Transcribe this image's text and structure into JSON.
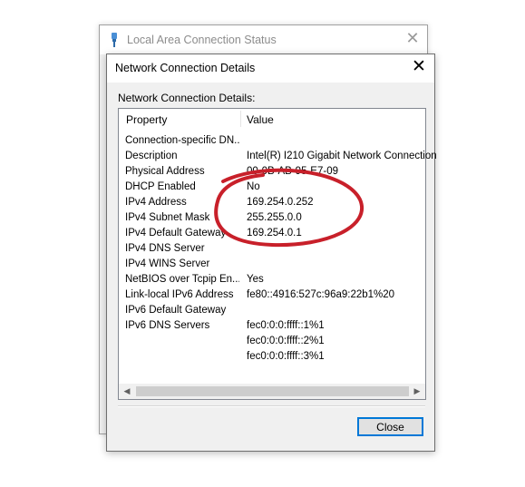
{
  "background_window": {
    "title": "Local Area Connection Status",
    "icon": "network-cable-icon",
    "close_glyph": "✕"
  },
  "dialog": {
    "title": "Network Connection Details",
    "close_glyph": "✕",
    "group_label": "Network Connection Details:",
    "columns": {
      "property": "Property",
      "value": "Value"
    },
    "rows": [
      {
        "property": "Connection-specific DN...",
        "value": ""
      },
      {
        "property": "Description",
        "value": "Intel(R) I210 Gigabit Network Connection"
      },
      {
        "property": "Physical Address",
        "value": "00-0B-AB-95-E7-09"
      },
      {
        "property": "DHCP Enabled",
        "value": "No"
      },
      {
        "property": "IPv4 Address",
        "value": "169.254.0.252"
      },
      {
        "property": "IPv4 Subnet Mask",
        "value": "255.255.0.0"
      },
      {
        "property": "IPv4 Default Gateway",
        "value": "169.254.0.1"
      },
      {
        "property": "IPv4 DNS Server",
        "value": ""
      },
      {
        "property": "IPv4 WINS Server",
        "value": ""
      },
      {
        "property": "NetBIOS over Tcpip En...",
        "value": "Yes"
      },
      {
        "property": "Link-local IPv6 Address",
        "value": "fe80::4916:527c:96a9:22b1%20"
      },
      {
        "property": "IPv6 Default Gateway",
        "value": ""
      },
      {
        "property": "IPv6 DNS Servers",
        "value": "fec0:0:0:ffff::1%1"
      },
      {
        "property": "",
        "value": "fec0:0:0:ffff::2%1"
      },
      {
        "property": "",
        "value": "fec0:0:0:ffff::3%1"
      }
    ],
    "scroll_left_glyph": "◀",
    "scroll_right_glyph": "▶",
    "close_button_label": "Close"
  },
  "annotation": {
    "color": "#c8202a",
    "shape": "ellipse"
  }
}
